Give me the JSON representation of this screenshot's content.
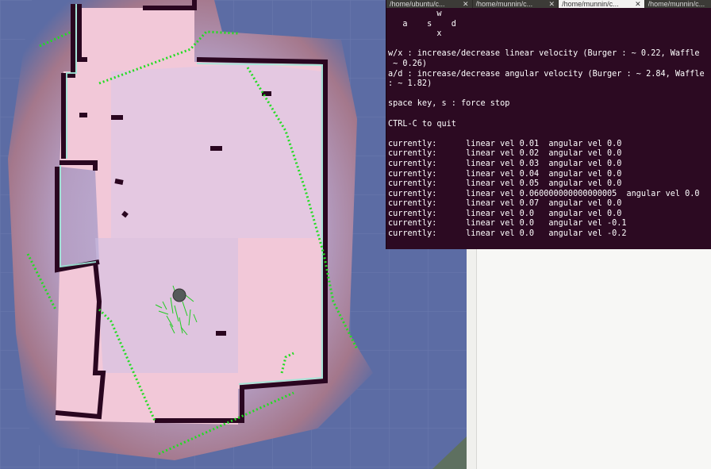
{
  "terminal": {
    "tabs": [
      {
        "title": "/home/ubuntu/c...",
        "active": false
      },
      {
        "title": "/home/munnin/c...",
        "active": false
      },
      {
        "title": "/home/munnin/c...",
        "active": true
      },
      {
        "title": "/home/munnin/c...",
        "active": false
      }
    ],
    "lines": [
      "          w",
      "   a    s    d",
      "          x",
      "",
      "w/x : increase/decrease linear velocity (Burger : ~ 0.22, Waffle",
      " ~ 0.26)",
      "a/d : increase/decrease angular velocity (Burger : ~ 2.84, Waffle",
      ": ~ 1.82)",
      "",
      "space key, s : force stop",
      "",
      "CTRL-C to quit",
      "",
      "currently:      linear vel 0.01  angular vel 0.0",
      "currently:      linear vel 0.02  angular vel 0.0",
      "currently:      linear vel 0.03  angular vel 0.0",
      "currently:      linear vel 0.04  angular vel 0.0",
      "currently:      linear vel 0.05  angular vel 0.0",
      "currently:      linear vel 0.060000000000000005  angular vel 0.0",
      "currently:      linear vel 0.07  angular vel 0.0",
      "currently:      linear vel 0.0   angular vel 0.0",
      "currently:      linear vel 0.0   angular vel -0.1",
      "currently:      linear vel 0.0   angular vel -0.2"
    ]
  },
  "map": {
    "background_color": "#5c6ca4",
    "room_fill_color": "#f2c8d8",
    "wall_color": "#2a0620",
    "laser_color": "#22dd22",
    "robot_icon": "robot-icon"
  }
}
